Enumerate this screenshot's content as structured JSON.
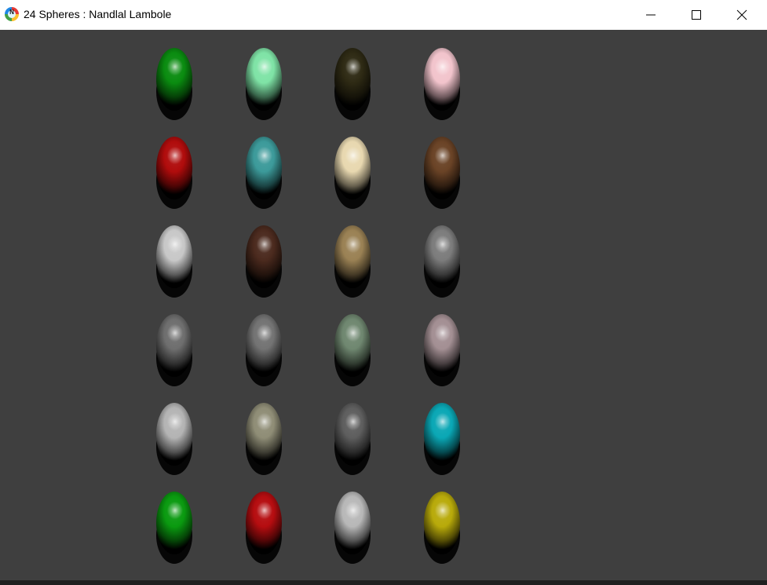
{
  "window": {
    "title": "24 Spheres : Nandlal Lambole",
    "icon": "app-logo-icon",
    "icon_letter": "N",
    "background": "#3f3f3f"
  },
  "controls": [
    "minimize-icon",
    "maximize-icon",
    "close-icon"
  ],
  "spheres": [
    [
      "#0a8c10",
      "#7fe3a6",
      "#2e2a14",
      "#f2c4cc"
    ],
    [
      "#b00c0c",
      "#3c9a9a",
      "#e8d8b0",
      "#6a4326"
    ],
    [
      "#c8c8c8",
      "#4b2a1e",
      "#9a8154",
      "#7c7c7c"
    ],
    [
      "#6e6e6e",
      "#737373",
      "#6f8770",
      "#a38f93"
    ],
    [
      "#b4b4b4",
      "#8f8d76",
      "#5e5e5e",
      "#0aa7b5"
    ],
    [
      "#0a9a10",
      "#b50d10",
      "#b8b8b8",
      "#b8aa0a"
    ]
  ]
}
